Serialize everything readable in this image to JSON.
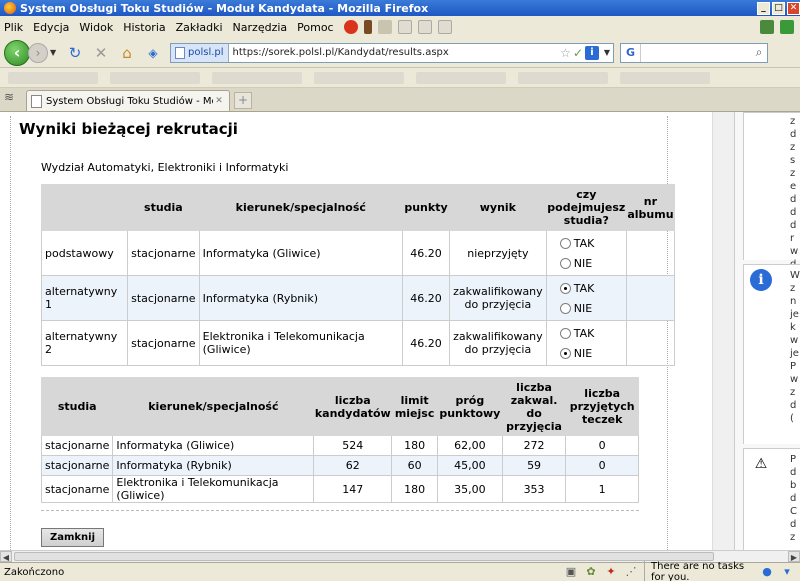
{
  "window": {
    "title": "System Obsługi Toku Studiów - Moduł Kandydata - Mozilla Firefox",
    "controls": [
      "_",
      "□",
      "✕"
    ]
  },
  "menu": [
    "Plik",
    "Edycja",
    "Widok",
    "Historia",
    "Zakładki",
    "Narzędzia",
    "Pomoc"
  ],
  "nav": {
    "site_label": "polsl.pl",
    "url": "https://sorek.polsl.pl/Kandydat/results.aspx",
    "search_placeholder": "",
    "search_engine_letter": "G"
  },
  "tab": {
    "label": "System Obsługi Toku Studiów - Mod...",
    "close": "✕",
    "new_tab": "+"
  },
  "page": {
    "title": "Wyniki bieżącej rekrutacji",
    "faculty": "Wydział Automatyki, Elektroniki i Informatyki",
    "results_headers": [
      "",
      "studia",
      "kierunek/specjalność",
      "punkty",
      "wynik",
      "czy podejmujesz studia?",
      "nr albumu"
    ],
    "results_rows": [
      {
        "rodzaj": "podstawowy",
        "studia": "stacjonarne",
        "kierunek": "Informatyka (Gliwice)",
        "punkty": "46.20",
        "wynik": "nieprzyjęty",
        "tak_label": "TAK",
        "nie_label": "NIE",
        "selected": "none",
        "album": ""
      },
      {
        "rodzaj": "alternatywny 1",
        "studia": "stacjonarne",
        "kierunek": "Informatyka (Rybnik)",
        "punkty": "46.20",
        "wynik": "zakwalifikowany do przyjęcia",
        "tak_label": "TAK",
        "nie_label": "NIE",
        "selected": "TAK",
        "album": ""
      },
      {
        "rodzaj": "alternatywny 2",
        "studia": "stacjonarne",
        "kierunek": "Elektronika i Telekomunikacja (Gliwice)",
        "punkty": "46.20",
        "wynik": "zakwalifikowany do przyjęcia",
        "tak_label": "TAK",
        "nie_label": "NIE",
        "selected": "NIE",
        "album": ""
      }
    ],
    "stats_headers": [
      "studia",
      "kierunek/specjalność",
      "liczba kandydatów",
      "limit miejsc",
      "próg punktowy",
      "liczba zakwal. do przyjęcia",
      "liczba przyjętych teczek"
    ],
    "stats_rows": [
      {
        "studia": "stacjonarne",
        "kierunek": "Informatyka (Gliwice)",
        "kandydaci": "524",
        "limit": "180",
        "prog": "62,00",
        "zakwal": "272",
        "teczki": "0"
      },
      {
        "studia": "stacjonarne",
        "kierunek": "Informatyka (Rybnik)",
        "kandydaci": "62",
        "limit": "60",
        "prog": "45,00",
        "zakwal": "59",
        "teczki": "0"
      },
      {
        "studia": "stacjonarne",
        "kierunek": "Elektronika i Telekomunikacja (Gliwice)",
        "kandydaci": "147",
        "limit": "180",
        "prog": "35,00",
        "zakwal": "353",
        "teczki": "1"
      }
    ],
    "close_button": "Zamknij"
  },
  "side_panel": {
    "box1_letters": [
      "z",
      "d",
      "z",
      "s",
      "z",
      "e",
      "d",
      "d",
      "d",
      "r",
      "w",
      "d"
    ],
    "box2_letters": [
      "W",
      "z",
      "n",
      "je",
      "k",
      "w",
      "je",
      "P",
      "w",
      "z",
      "d",
      "("
    ],
    "box3_letters": [
      "P",
      "d",
      "b",
      "d",
      "C",
      "d",
      "z"
    ]
  },
  "status": {
    "text": "Zakończono",
    "tasks": "There are no tasks for you."
  },
  "colors": {
    "header_bg": "#d7d7d7",
    "row_highlight": "#edf3fb",
    "titlebar": "#1f57c3"
  }
}
